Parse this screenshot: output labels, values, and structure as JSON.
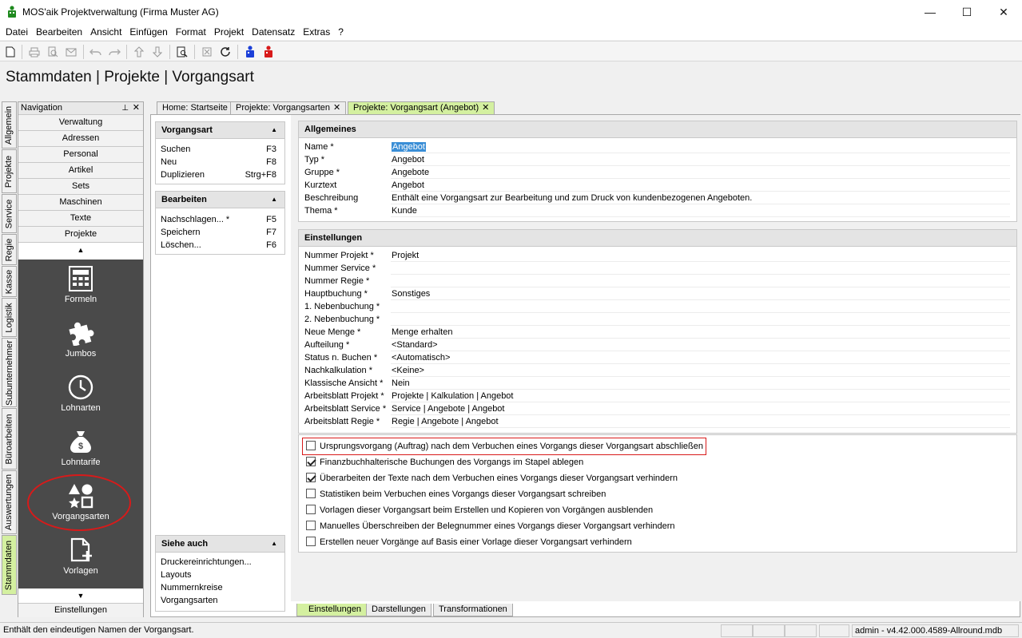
{
  "window": {
    "title": "MOS'aik Projektverwaltung (Firma Muster AG)",
    "minimize": "—",
    "maximize": "☐",
    "close": "✕"
  },
  "menu": [
    "Datei",
    "Bearbeiten",
    "Ansicht",
    "Einfügen",
    "Format",
    "Projekt",
    "Datensatz",
    "Extras",
    "?"
  ],
  "page_title": "Stammdaten | Projekte | Vorgangsart",
  "vertical_tabs": [
    "Allgemein",
    "Projekte",
    "Service",
    "Regie",
    "Kasse",
    "Logistik",
    "Subunternehmer",
    "Büroarbeiten",
    "Auswertungen",
    "Stammdaten"
  ],
  "navigation": {
    "header": "Navigation",
    "items": [
      "Verwaltung",
      "Adressen",
      "Personal",
      "Artikel",
      "Sets",
      "Maschinen",
      "Texte",
      "Projekte"
    ],
    "big_items": [
      "Formeln",
      "Jumbos",
      "Lohnarten",
      "Lohntarife",
      "Vorgangsarten",
      "Vorlagen"
    ],
    "footer": "Einstellungen"
  },
  "doc_tabs": [
    {
      "label": "Home: Startseite"
    },
    {
      "label": "Projekte: Vorgangsarten"
    },
    {
      "label": "Projekte: Vorgangsart (Angebot)"
    }
  ],
  "panels": {
    "vorgangsart": {
      "title": "Vorgangsart",
      "items": [
        {
          "label": "Suchen",
          "key": "F3"
        },
        {
          "label": "Neu",
          "key": "F8"
        },
        {
          "label": "Duplizieren",
          "key": "Strg+F8"
        }
      ]
    },
    "bearbeiten": {
      "title": "Bearbeiten",
      "items": [
        {
          "label": "Nachschlagen... *",
          "key": "F5"
        },
        {
          "label": "Speichern",
          "key": "F7"
        },
        {
          "label": "Löschen...",
          "key": "F6"
        }
      ]
    },
    "siehe_auch": {
      "title": "Siehe auch",
      "items": [
        "Druckereinrichtungen...",
        "Layouts",
        "Nummernkreise",
        "Vorgangsarten"
      ]
    }
  },
  "allgemeines": {
    "title": "Allgemeines",
    "rows": [
      {
        "label": "Name *",
        "value": "Angebot"
      },
      {
        "label": "Typ *",
        "value": "Angebot"
      },
      {
        "label": "Gruppe *",
        "value": "Angebote"
      },
      {
        "label": "Kurztext",
        "value": "Angebot"
      },
      {
        "label": "Beschreibung",
        "value": "Enthält eine Vorgangsart zur Bearbeitung und zum Druck von kundenbezogenen Angeboten."
      },
      {
        "label": "Thema *",
        "value": "Kunde"
      }
    ]
  },
  "einstellungen": {
    "title": "Einstellungen",
    "rows": [
      {
        "label": "Nummer Projekt *",
        "value": "Projekt"
      },
      {
        "label": "Nummer Service *",
        "value": ""
      },
      {
        "label": "Nummer Regie *",
        "value": ""
      },
      {
        "label": "Hauptbuchung *",
        "value": "Sonstiges"
      },
      {
        "label": "1. Nebenbuchung *",
        "value": ""
      },
      {
        "label": "2. Nebenbuchung *",
        "value": ""
      },
      {
        "label": "Neue Menge *",
        "value": "Menge erhalten"
      },
      {
        "label": "Aufteilung *",
        "value": "<Standard>"
      },
      {
        "label": "Status n. Buchen *",
        "value": "<Automatisch>"
      },
      {
        "label": "Nachkalkulation *",
        "value": "<Keine>"
      },
      {
        "label": "Klassische Ansicht *",
        "value": "Nein"
      },
      {
        "label": "Arbeitsblatt Projekt *",
        "value": "Projekte | Kalkulation | Angebot"
      },
      {
        "label": "Arbeitsblatt Service *",
        "value": "Service | Angebote | Angebot"
      },
      {
        "label": "Arbeitsblatt Regie *",
        "value": "Regie | Angebote | Angebot"
      }
    ]
  },
  "checkboxes": [
    {
      "label": "Ursprungsvorgang (Auftrag) nach dem Verbuchen eines Vorgangs dieser Vorgangsart abschließen",
      "checked": false
    },
    {
      "label": "Finanzbuchhalterische Buchungen des Vorgangs im Stapel ablegen",
      "checked": true
    },
    {
      "label": "Überarbeiten der Texte nach dem Verbuchen eines Vorgangs dieser Vorgangsart verhindern",
      "checked": true
    },
    {
      "label": "Statistiken beim Verbuchen eines Vorgangs dieser Vorgangsart schreiben",
      "checked": false
    },
    {
      "label": "Vorlagen dieser Vorgangsart beim Erstellen und Kopieren von Vorgängen ausblenden",
      "checked": false
    },
    {
      "label": "Manuelles Überschreiben der Belegnummer eines Vorgangs dieser Vorgangsart verhindern",
      "checked": false
    },
    {
      "label": "Erstellen neuer Vorgänge auf Basis einer Vorlage dieser Vorgangsart verhindern",
      "checked": false
    }
  ],
  "bottom_tabs": [
    "Einstellungen",
    "Darstellungen",
    "Transformationen"
  ],
  "status": {
    "text": "Enthält den eindeutigen Namen der Vorgangsart.",
    "version": "admin - v4.42.000.4589-Allround.mdb"
  },
  "colors": {
    "active_tab": "#d4f0a0",
    "highlight": "#d81a1a",
    "nav_dark": "#4a4a4a",
    "selection": "#3a8ed6"
  }
}
